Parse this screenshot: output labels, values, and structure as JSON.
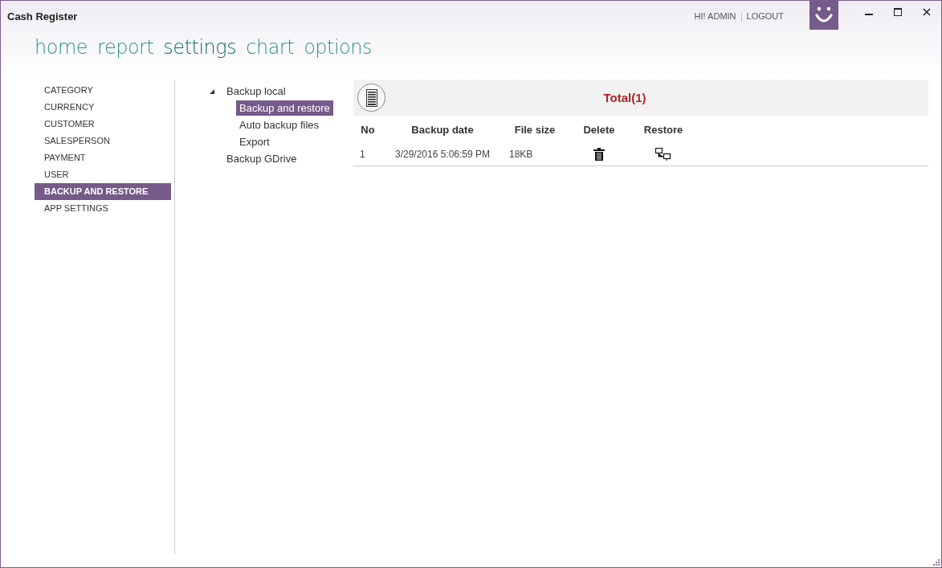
{
  "window": {
    "title": "Cash Register"
  },
  "user": {
    "greeting": "HI! ADMIN",
    "logout": "LOGOUT"
  },
  "nav": [
    {
      "label": "home",
      "selected": false
    },
    {
      "label": "report",
      "selected": false
    },
    {
      "label": "settings",
      "selected": true
    },
    {
      "label": "chart",
      "selected": false
    },
    {
      "label": "options",
      "selected": false
    }
  ],
  "sidebar": {
    "items": [
      {
        "label": "CATEGORY",
        "selected": false
      },
      {
        "label": "CURRENCY",
        "selected": false
      },
      {
        "label": "CUSTOMER",
        "selected": false
      },
      {
        "label": "SALESPERSON",
        "selected": false
      },
      {
        "label": "PAYMENT",
        "selected": false
      },
      {
        "label": "USER",
        "selected": false
      },
      {
        "label": "BACKUP AND RESTORE",
        "selected": true
      },
      {
        "label": "APP SETTINGS",
        "selected": false
      }
    ]
  },
  "tree": [
    {
      "label": "Backup local",
      "expanded": true,
      "selected": false,
      "children": [
        {
          "label": "Backup and restore",
          "selected": true
        },
        {
          "label": "Auto backup files",
          "selected": false
        },
        {
          "label": "Export",
          "selected": false
        }
      ]
    },
    {
      "label": "Backup GDrive",
      "selected": false
    }
  ],
  "panel": {
    "total": "Total(1)"
  },
  "table": {
    "columns": [
      "No",
      "Backup date",
      "File size",
      "Delete",
      "Restore"
    ],
    "rows": [
      {
        "no": "1",
        "date": "3/29/2016 5:06:59 PM",
        "size": "18KB"
      }
    ]
  }
}
